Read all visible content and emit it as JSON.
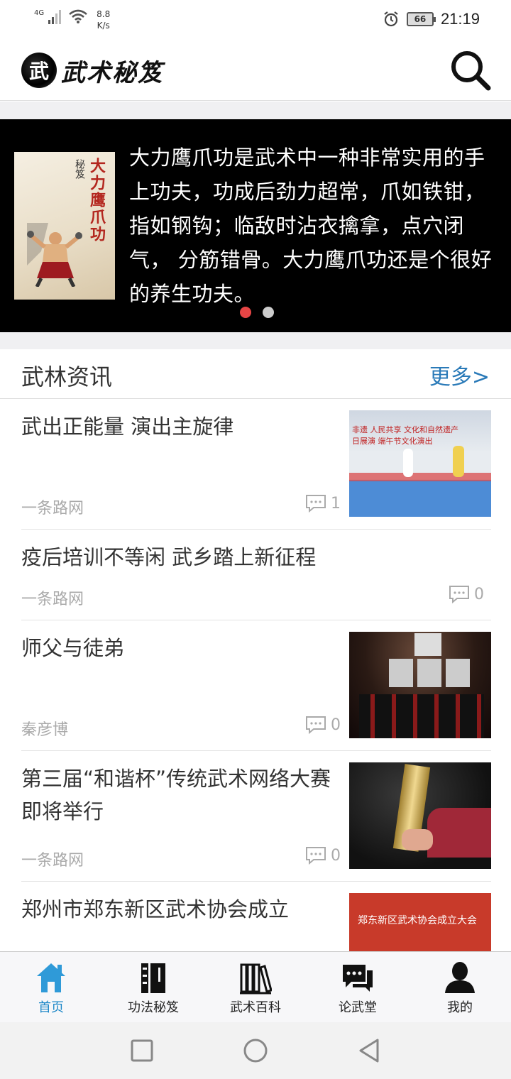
{
  "status_bar": {
    "network": "4G",
    "speed_value": "8.8",
    "speed_unit": "K/s",
    "battery": "66",
    "time": "21:19"
  },
  "header": {
    "logo_seal": "武",
    "logo_text": "武术秘笈"
  },
  "banner": {
    "book_title": "大力鹰爪功",
    "book_subtitle": "秘笈",
    "text": "大力鹰爪功是武术中一种非常实用的手上功夫，功成后劲力超常，爪如铁钳，指如钢钩；临敌时沾衣擒拿，点穴闭气， 分筋错骨。大力鹰爪功还是个很好的养生功夫。",
    "dots": 2,
    "active_dot": 0
  },
  "section": {
    "title": "武林资讯",
    "more": "更多>"
  },
  "news": [
    {
      "title": "武出正能量 演出主旋律",
      "source": "一条路网",
      "comments": "1",
      "has_thumb": true
    },
    {
      "title": "疫后培训不等闲 武乡踏上新征程",
      "source": "一条路网",
      "comments": "0",
      "has_thumb": false
    },
    {
      "title": "师父与徒弟",
      "source": "秦彦博",
      "comments": "0",
      "has_thumb": true
    },
    {
      "title": "第三届“和谐杯”传统武术网络大赛 即将举行",
      "source": "一条路网",
      "comments": "0",
      "has_thumb": true
    },
    {
      "title": "郑州市郑东新区武术协会成立",
      "source": "",
      "comments": "",
      "has_thumb": true
    }
  ],
  "thumb_text": {
    "news1_banner": "非遗  人民共享 文化和自然遗产日展演 端午节文化演出",
    "news5_banner": "郑东新区武术协会成立大会"
  },
  "bottom_nav": [
    {
      "label": "首页",
      "icon": "home-icon",
      "active": true
    },
    {
      "label": "功法秘笈",
      "icon": "book-icon",
      "active": false
    },
    {
      "label": "武术百科",
      "icon": "library-icon",
      "active": false
    },
    {
      "label": "论武堂",
      "icon": "chat-icon",
      "active": false
    },
    {
      "label": "我的",
      "icon": "person-icon",
      "active": false
    }
  ],
  "colors": {
    "accent": "#1e88c8",
    "more_link": "#2a7ab8",
    "active_dot": "#e64545",
    "banner_bg": "#000000"
  }
}
